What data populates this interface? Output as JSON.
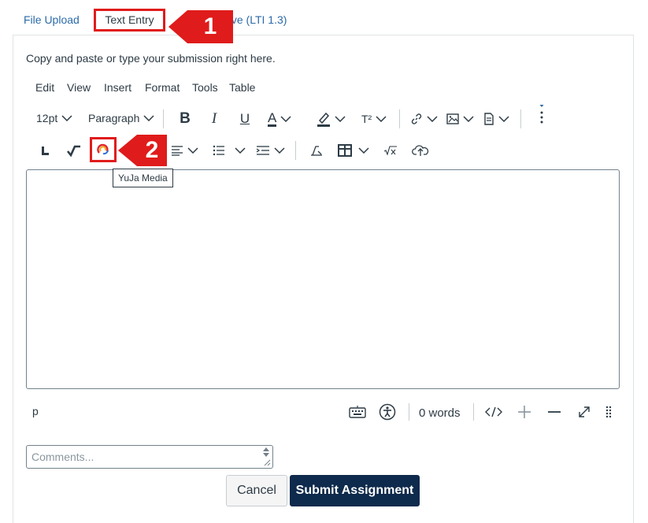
{
  "tabs": {
    "file_upload": "File Upload",
    "text_entry": "Text Entry",
    "drive": "Drive (LTI 1.3)"
  },
  "instructions": "Copy and paste or type your submission right here.",
  "menubar": {
    "edit": "Edit",
    "view": "View",
    "insert": "Insert",
    "format": "Format",
    "tools": "Tools",
    "table": "Table"
  },
  "toolbar": {
    "font_size": "12pt",
    "block_format": "Paragraph",
    "bold_icon": "B",
    "italic_icon": "I",
    "underline_icon": "U",
    "text_color_icon": "A",
    "superscript_icon": "T²"
  },
  "tooltip": "YuJa Media",
  "callouts": {
    "step1": "1",
    "step2": "2",
    "color": "#e01b1b"
  },
  "statusbar": {
    "element_path": "p",
    "word_count": "0 words"
  },
  "comments": {
    "placeholder": "Comments..."
  },
  "actions": {
    "cancel": "Cancel",
    "submit": "Submit Assignment"
  },
  "colors": {
    "link": "#2a6aa8",
    "submit_bg": "#0e2a4c",
    "highlight_red": "#e01b1b"
  }
}
